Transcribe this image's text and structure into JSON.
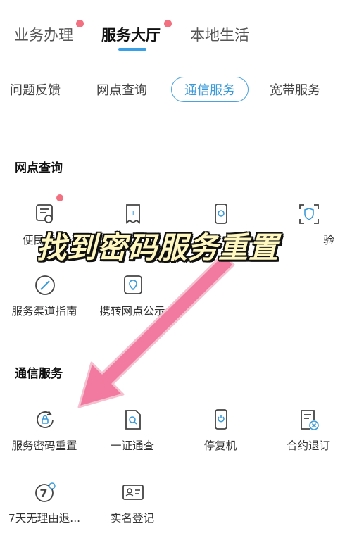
{
  "top_tabs": [
    {
      "label": "业务办理"
    },
    {
      "label": "服务大厅"
    },
    {
      "label": "本地生活"
    }
  ],
  "sub_tabs": [
    {
      "label": "问题反馈"
    },
    {
      "label": "网点查询"
    },
    {
      "label": "通信服务"
    },
    {
      "label": "宽带服务"
    }
  ],
  "sections": {
    "wangdian": {
      "title": "网点查询",
      "items": [
        {
          "label": "便民服务",
          "icon": "phone-card-icon"
        },
        {
          "label": "",
          "icon": "receipt-icon"
        },
        {
          "label": "",
          "icon": "mobile-icon"
        },
        {
          "label": "验",
          "icon": "shield-scan-icon"
        },
        {
          "label": "服务渠道指南",
          "icon": "compass-icon"
        },
        {
          "label": "携转网点公示",
          "icon": "map-pin-icon"
        }
      ]
    },
    "tongxin": {
      "title": "通信服务",
      "items": [
        {
          "label": "服务密码重置",
          "icon": "lock-reset-icon"
        },
        {
          "label": "一证通查",
          "icon": "doc-search-icon"
        },
        {
          "label": "停复机",
          "icon": "phone-power-icon"
        },
        {
          "label": "合约退订",
          "icon": "contract-cancel-icon"
        },
        {
          "label": "7天无理由退...",
          "icon": "seven-day-icon"
        },
        {
          "label": "实名登记",
          "icon": "id-card-icon"
        }
      ]
    }
  },
  "overlay": {
    "text": "找到密码服务重置"
  },
  "colors": {
    "accent": "#3b9ad8",
    "dot": "#f2707f",
    "arrow": "#f27aa0",
    "banner_fill": "#fff7c0"
  }
}
